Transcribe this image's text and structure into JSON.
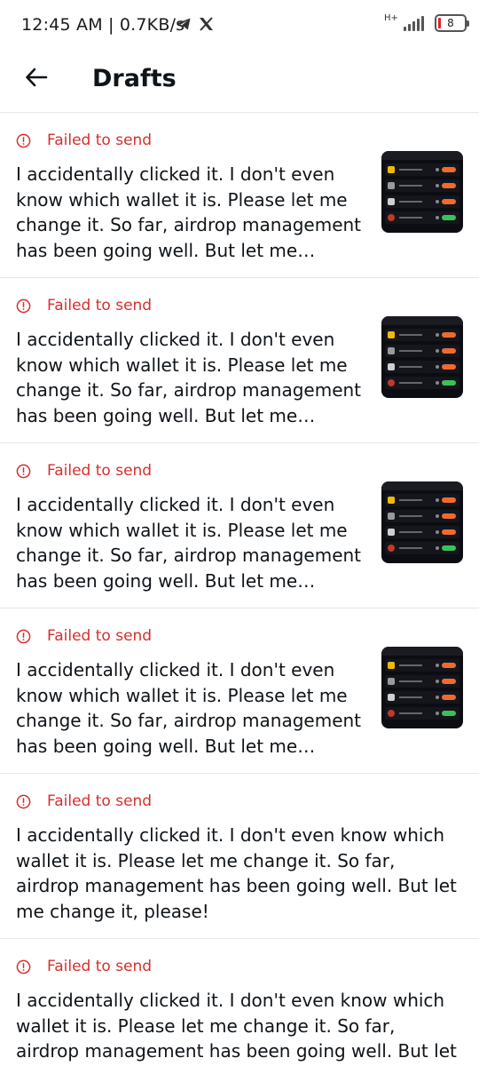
{
  "status_bar": {
    "time_speed": "12:45 AM | 0.7KB/s",
    "network_type": "H+",
    "battery_level": "8",
    "telegram_icon": "telegram-icon",
    "x_icon": "x-logo-icon",
    "battery_color": "#e0242a"
  },
  "header": {
    "title": "Drafts",
    "back_icon": "arrow-left-icon"
  },
  "drafts": [
    {
      "status": "Failed to send",
      "text": "I accidentally clicked it. I don't even know which wallet it is. Please let me change it. So far, airdrop management has been going well. But let me change it, please!",
      "has_image": true
    },
    {
      "status": "Failed to send",
      "text": "I accidentally clicked it. I don't even know which wallet it is. Please let me change it. So far, airdrop management has been going well. But let me change it, please!",
      "has_image": true
    },
    {
      "status": "Failed to send",
      "text": "I accidentally clicked it. I don't even know which wallet it is. Please let me change it. So far, airdrop management has been going well. But let me change it, please!",
      "has_image": true
    },
    {
      "status": "Failed to send",
      "text": "I accidentally clicked it. I don't even know which wallet it is. Please let me change it. So far, airdrop management has been going well. But let me change it, please!",
      "has_image": true
    },
    {
      "status": "Failed to send",
      "text": "I accidentally clicked it. I don't even know which wallet it is. Please let me change it. So far, airdrop management has been going well. But let me change it, please!",
      "has_image": false
    },
    {
      "status": "Failed to send",
      "text": "I accidentally clicked it. I don't even know which wallet it is. Please let me change it. So far, airdrop management has been going well. But let me change it, please!",
      "has_image": false
    }
  ],
  "colors": {
    "error": "#d62f2f",
    "text": "#0f1419",
    "divider": "#e6e6e6"
  }
}
